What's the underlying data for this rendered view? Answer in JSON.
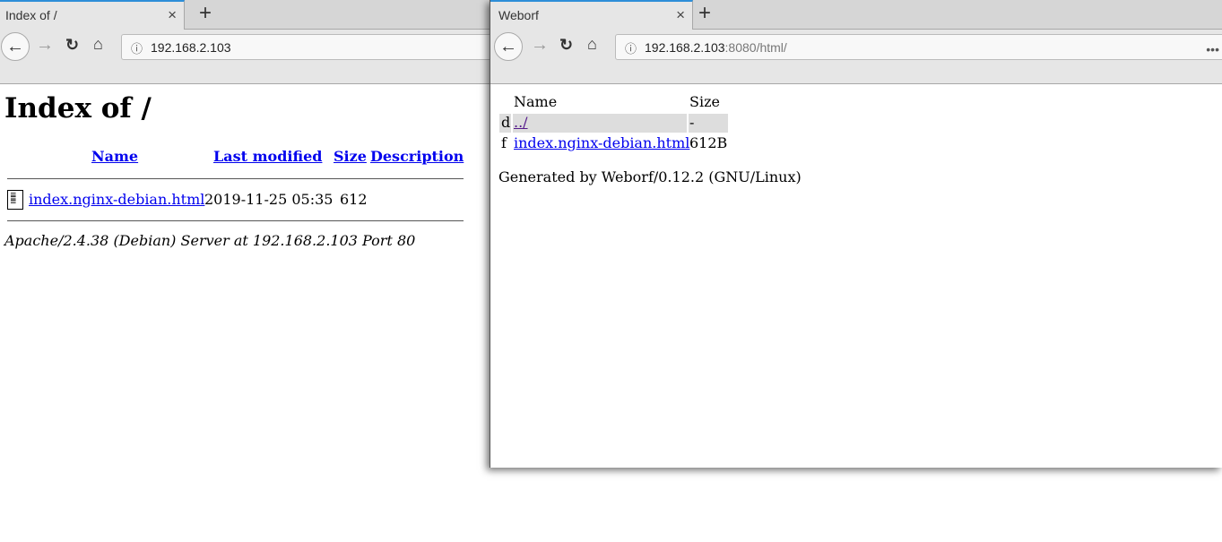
{
  "left_window": {
    "tab_title": "Index of /",
    "url": "192.168.2.103",
    "heading": "Index of /",
    "columns": [
      "Name",
      "Last modified",
      "Size",
      "Description"
    ],
    "rows": [
      {
        "name": "index.nginx-debian.html",
        "modified": "2019-11-25 05:35",
        "size": "612",
        "description": ""
      }
    ],
    "footer": "Apache/2.4.38 (Debian) Server at 192.168.2.103 Port 80"
  },
  "right_window": {
    "tab_title": "Weborf",
    "url_host": "192.168.2.103",
    "url_rest": ":8080/html/",
    "columns": [
      "Name",
      "Size"
    ],
    "rows": [
      {
        "type": "d",
        "name": "../",
        "size": "-"
      },
      {
        "type": "f",
        "name": "index.nginx-debian.html",
        "size": "612B"
      }
    ],
    "footer": "Generated by Weborf/0.12.2 (GNU/Linux)"
  },
  "icons": {
    "back": "←",
    "forward": "→",
    "reload": "↻",
    "home": "⌂",
    "info": "ⓘ",
    "close": "×",
    "new_tab": "+",
    "menu": "•••"
  }
}
